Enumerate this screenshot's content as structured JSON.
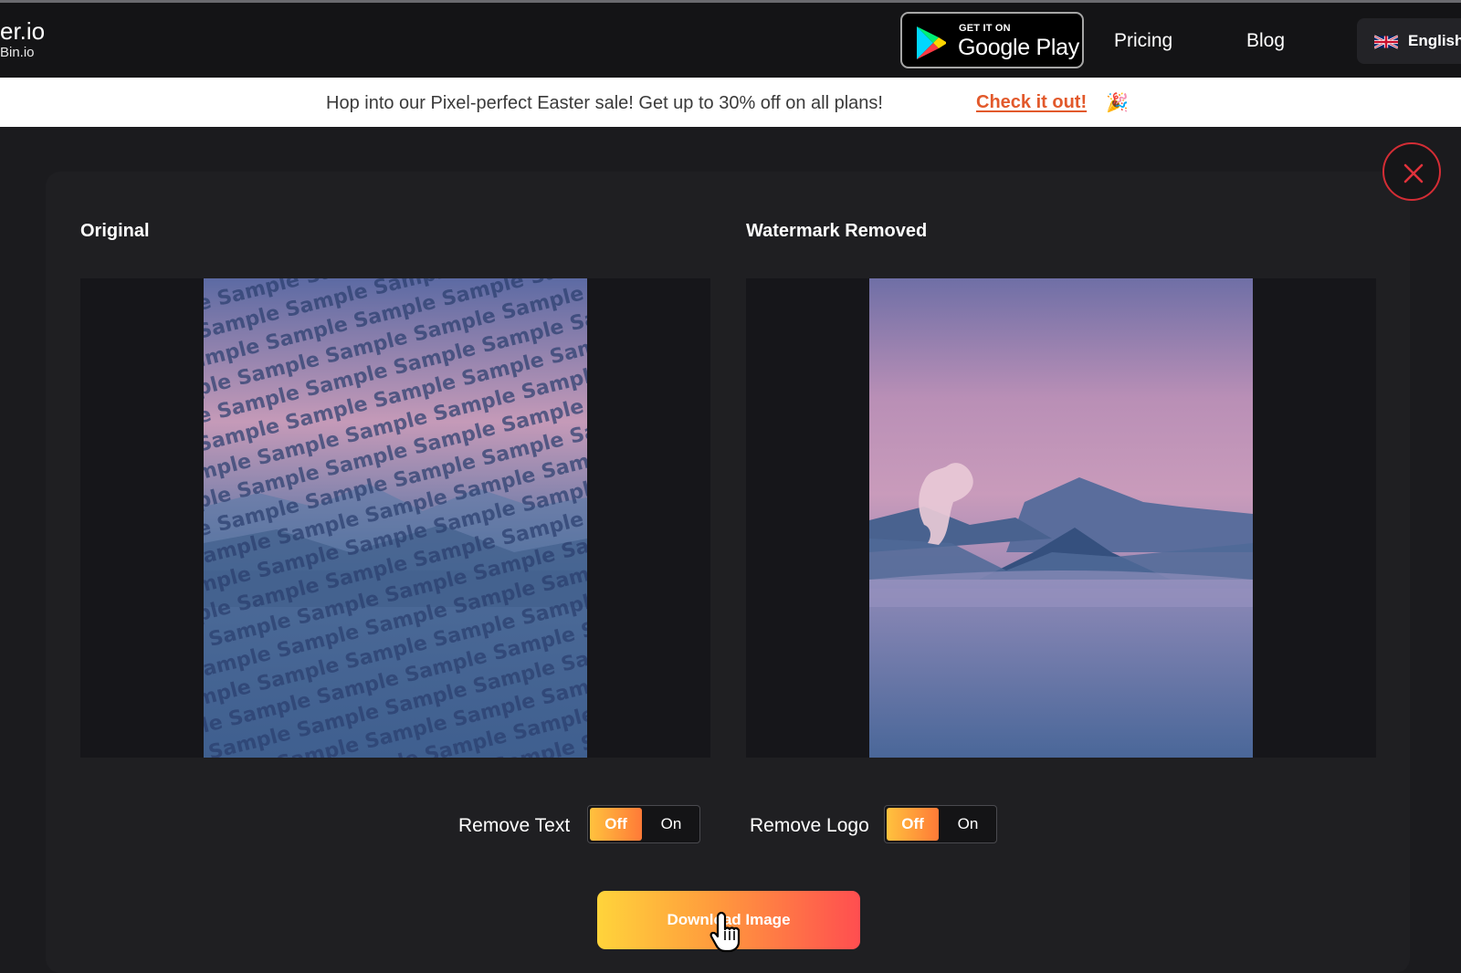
{
  "nav": {
    "brand_main": "er.io",
    "brand_sub": "Bin.io",
    "gplay_top": "GET IT ON",
    "gplay_main": "Google Play",
    "links": [
      "Pricing",
      "Blog"
    ],
    "language": "English",
    "language_flag_icon": "uk-flag-icon"
  },
  "promo": {
    "text": "Hop into our Pixel-perfect Easter sale! Get up to 30% off on all plans!",
    "link": "Check it out!",
    "emoji": "🎉"
  },
  "modal": {
    "close_icon": "close-icon",
    "original_title": "Original",
    "removed_title": "Watermark Removed",
    "watermark_word": "Sample",
    "remove_text_label": "Remove Text",
    "remove_logo_label": "Remove Logo",
    "toggle_off": "Off",
    "toggle_on": "On",
    "remove_text_state": "Off",
    "remove_logo_state": "Off",
    "download_label": "Download Image"
  },
  "colors": {
    "accent_orange": "#ff7a37",
    "link_orange": "#e2592b",
    "close_red": "#d42d35"
  }
}
